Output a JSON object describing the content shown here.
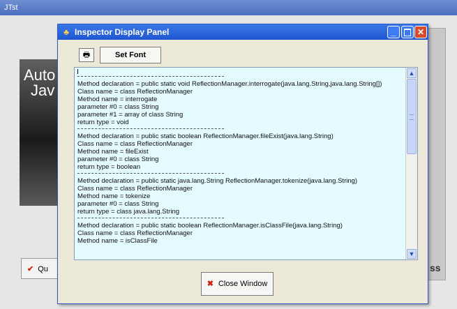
{
  "background_window": {
    "title": "JTst",
    "logo_line1": "Auto",
    "logo_line2": "Jav",
    "quit_label": "Qu",
    "right_text": "ss"
  },
  "dialog": {
    "title": "Inspector Display Panel",
    "set_font_label": "Set Font",
    "close_label": "Close Window",
    "content": [
      {
        "lines": [
          "Method declaration = public static void ReflectionManager.interrogate(java.lang.String,java.lang.String[])",
          "Class name = class ReflectionManager",
          "Method name = interrogate",
          "parameter #0 = class String",
          "parameter #1 = array of class String",
          "return type = void"
        ]
      },
      {
        "lines": [
          "Method declaration = public static boolean ReflectionManager.fileExist(java.lang.String)",
          "Class name = class ReflectionManager",
          "Method name = fileExist",
          "parameter #0 = class String",
          "return type = boolean"
        ]
      },
      {
        "lines": [
          "Method declaration = public static java.lang.String ReflectionManager.tokenize(java.lang.String)",
          "Class name = class ReflectionManager",
          "Method name = tokenize",
          "parameter #0 = class String",
          "return type = class java.lang.String"
        ]
      },
      {
        "lines": [
          "Method declaration = public static boolean ReflectionManager.isClassFile(java.lang.String)",
          "Class name = class ReflectionManager",
          "Method name = isClassFile"
        ]
      }
    ]
  },
  "icons": {
    "app": "app-icon",
    "printer": "printer-icon",
    "close": "close-x-icon",
    "quit": "checkmark-icon"
  },
  "colors": {
    "titlebar": "#1f57d0",
    "textarea_bg": "#e4fbff",
    "close_x": "#cc2211"
  }
}
